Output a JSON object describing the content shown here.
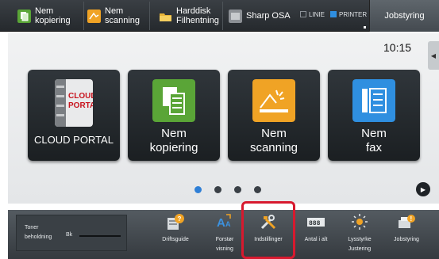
{
  "topbar": {
    "quick_buttons": [
      {
        "label": "Nem\nkopiering",
        "icon": "copy-icon",
        "color": "#5aa537"
      },
      {
        "label": "Nem\nscanning",
        "icon": "scan-icon",
        "color": "#f0a325"
      },
      {
        "label": "Harddisk\nFilhentning",
        "icon": "folder-icon",
        "color": "#e6b338"
      },
      {
        "label": "Sharp OSA",
        "icon": "osa-icon",
        "color": "#9b9fa3"
      }
    ],
    "status": {
      "line_label": "LINIE",
      "printer_label": "PRINTER",
      "printer_color": "#2f8fe0"
    },
    "job_button": "Jobstyring"
  },
  "main": {
    "clock": "10:15",
    "tiles": [
      {
        "label": "CLOUD PORTAL",
        "icon": "cloud-portal-icon",
        "logo_text": "CLOUD\nPORTAL"
      },
      {
        "label": "Nem\nkopiering",
        "icon": "copy-icon",
        "color": "#5aa537"
      },
      {
        "label": "Nem\nscanning",
        "icon": "scan-icon",
        "color": "#f0a325"
      },
      {
        "label": "Nem\nfax",
        "icon": "fax-icon",
        "color": "#2f8fe0"
      }
    ],
    "page_dots": 4,
    "active_page": 1
  },
  "bottom": {
    "toner_label": "Toner\nbeholdning",
    "toner_color_label": "Bk",
    "items": [
      {
        "label": "Driftsguide",
        "icon": "guide-icon"
      },
      {
        "label": "Forstør\nvisning",
        "icon": "enlarge-icon"
      },
      {
        "label": "Indstillinger",
        "icon": "settings-icon"
      },
      {
        "label": "Antal i alt",
        "icon": "counter-icon"
      },
      {
        "label": "Lysstyrke\nJustering",
        "icon": "brightness-icon"
      },
      {
        "label": "Jobstyring",
        "icon": "job-status-icon"
      }
    ],
    "highlighted": "Indstillinger"
  }
}
